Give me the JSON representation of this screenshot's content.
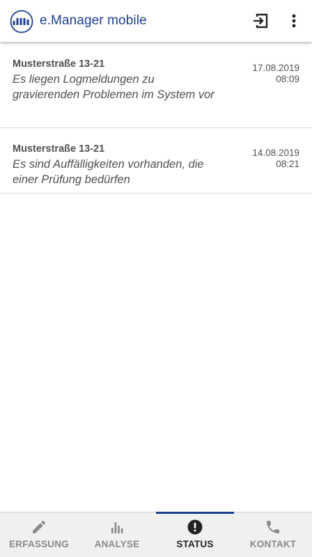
{
  "app": {
    "title": "e.Manager mobile",
    "brand_color": "#1a3f8f"
  },
  "toolbar": {
    "logout_icon": "logout-icon",
    "more_icon": "more-vert-icon"
  },
  "messages": [
    {
      "location": "Musterstraße 13-21",
      "text": "Es liegen Logmeldungen zu gravierenden Problemen im System vor",
      "date": "17.08.2019",
      "time": "08:09"
    },
    {
      "location": "Musterstraße 13-21",
      "text": "Es sind Auffälligkeiten vorhanden, die einer Prüfung bedürfen",
      "date": "14.08.2019",
      "time": "08:21"
    }
  ],
  "nav": {
    "active": "STATUS",
    "items": [
      {
        "label": "ERFASSUNG",
        "icon": "pencil-icon"
      },
      {
        "label": "ANALYSE",
        "icon": "bar-chart-icon"
      },
      {
        "label": "STATUS",
        "icon": "alert-circle-icon"
      },
      {
        "label": "KONTAKT",
        "icon": "phone-icon"
      }
    ]
  }
}
